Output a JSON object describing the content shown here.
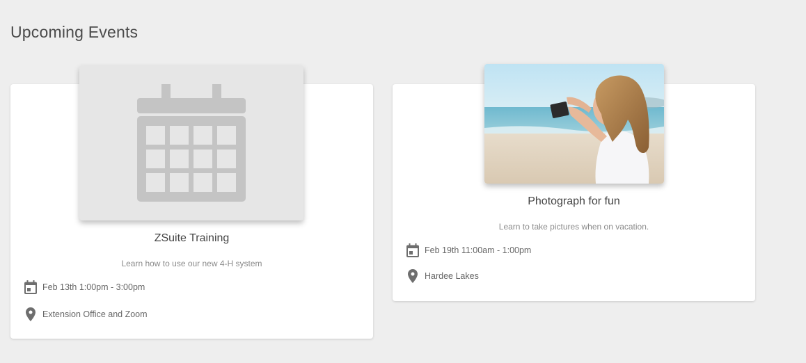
{
  "page": {
    "title": "Upcoming Events"
  },
  "events": [
    {
      "title": "ZSuite Training",
      "description": "Learn how to use our new 4-H system",
      "datetime": "Feb 13th 1:00pm - 3:00pm",
      "location": "Extension Office and Zoom",
      "image": "calendar-placeholder-icon"
    },
    {
      "title": "Photograph for fun",
      "description": "Learn to take pictures when on vacation.",
      "datetime": "Feb 19th 11:00am - 1:00pm",
      "location": "Hardee Lakes",
      "image": "beach-photo"
    }
  ],
  "colors": {
    "background": "#eeeeee",
    "card": "#ffffff",
    "placeholder_bg": "#e6e6e6",
    "placeholder_icon": "#c4c4c4",
    "icon": "#6e6e6e"
  }
}
